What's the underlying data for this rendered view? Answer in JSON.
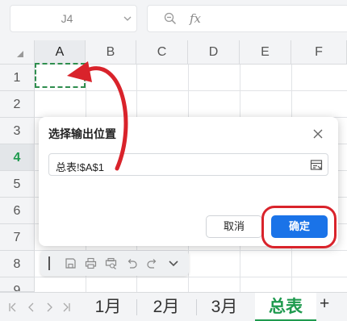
{
  "formula_bar": {
    "cell_ref": "J4",
    "fx_label": "fx"
  },
  "grid": {
    "columns": [
      "A",
      "B",
      "C",
      "D",
      "E",
      "F"
    ],
    "rows": [
      "1",
      "2",
      "3",
      "4",
      "5",
      "6",
      "7",
      "8",
      "9"
    ],
    "active_row": "4",
    "selected_column": "A"
  },
  "dialog": {
    "title": "选择输出位置",
    "input_value": "总表!$A$1",
    "cancel_label": "取消",
    "ok_label": "确定"
  },
  "sheet_tabs": [
    {
      "label": "1月",
      "active": false
    },
    {
      "label": "2月",
      "active": false
    },
    {
      "label": "3月",
      "active": false
    },
    {
      "label": "总表",
      "active": true
    }
  ],
  "add_sheet_label": "+",
  "colors": {
    "accent_green": "#1e9a4e",
    "primary_blue": "#1a73e8",
    "annotation_red": "#d9232b"
  }
}
